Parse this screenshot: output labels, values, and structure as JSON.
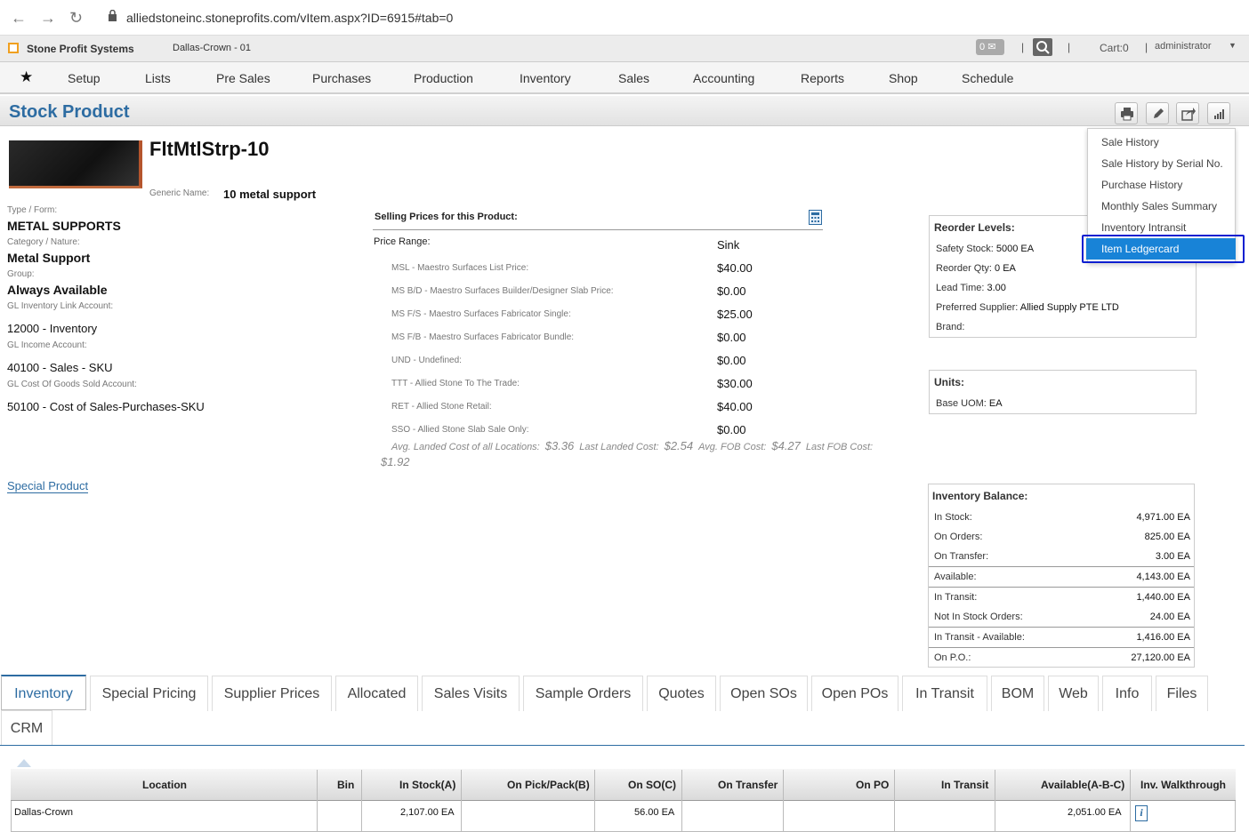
{
  "browser": {
    "url": "alliedstoneinc.stoneprofits.com/vItem.aspx?ID=6915#tab=0"
  },
  "appbar": {
    "app_name": "Stone Profit Systems",
    "location": "Dallas-Crown - 01",
    "msg_count": "0",
    "cart": "Cart:0",
    "user": "administrator"
  },
  "menu": [
    "Setup",
    "Lists",
    "Pre Sales",
    "Purchases",
    "Production",
    "Inventory",
    "Sales",
    "Accounting",
    "Reports",
    "Shop",
    "Schedule"
  ],
  "page": {
    "title": "Stock Product"
  },
  "dropdown": {
    "items": [
      "Sale History",
      "Sale History by Serial No.",
      "Purchase History",
      "Monthly Sales Summary",
      "Inventory Intransit"
    ],
    "selected": "Item Ledgercard"
  },
  "product": {
    "name": "FltMtlStrp-10",
    "generic_label": "Generic Name:",
    "generic_value": "10 metal support",
    "type_label": "Type / Form:",
    "type_value": "METAL SUPPORTS",
    "category_label": "Category / Nature:",
    "category_value": "Metal Support",
    "group_label": "Group:",
    "group_value": "Always Available",
    "gl_inv_label": "GL Inventory Link Account:",
    "gl_inv_value": "12000 - Inventory",
    "gl_inc_label": "GL Income Account:",
    "gl_inc_value": "40100 - Sales - SKU",
    "gl_cogs_label": "GL Cost Of Goods Sold Account:",
    "gl_cogs_value": "50100 - Cost of Sales-Purchases-SKU",
    "special_link": "Special Product"
  },
  "prices": {
    "heading": "Selling Prices for this Product:",
    "range_label": "Price Range:",
    "range_value": "Sink",
    "rows": [
      {
        "label": "MSL - Maestro Surfaces List Price:",
        "value": "$40.00"
      },
      {
        "label": "MS B/D - Maestro Surfaces Builder/Designer Slab Price:",
        "value": "$0.00"
      },
      {
        "label": "MS F/S - Maestro Surfaces Fabricator Single:",
        "value": "$25.00"
      },
      {
        "label": "MS F/B - Maestro Surfaces Fabricator Bundle:",
        "value": "$0.00"
      },
      {
        "label": "UND - Undefined:",
        "value": "$0.00"
      },
      {
        "label": "TTT - Allied Stone To The Trade:",
        "value": "$30.00"
      },
      {
        "label": "RET - Allied Stone Retail:",
        "value": "$40.00"
      },
      {
        "label": "SSO - Allied Stone Slab Sale Only:",
        "value": "$0.00"
      }
    ],
    "avg_landed_label": "Avg. Landed Cost of all Locations:",
    "avg_landed": "$3.36",
    "last_landed_label": "Last Landed Cost:",
    "last_landed": "$2.54",
    "avg_fob_label": "Avg. FOB Cost:",
    "avg_fob": "$4.27",
    "last_fob_label": "Last FOB Cost:",
    "last_fob": "$1.92"
  },
  "reorder": {
    "title": "Reorder Levels:",
    "safety_label": "Safety Stock:",
    "safety": "5000 EA",
    "qty_label": "Reorder Qty:",
    "qty": "0 EA",
    "lead_label": "Lead Time:",
    "lead": "3.00",
    "supplier_label": "Preferred Supplier:",
    "supplier": "Allied Supply PTE LTD",
    "brand_label": "Brand:"
  },
  "units": {
    "title": "Units:",
    "base_label": "Base UOM:",
    "base": "EA"
  },
  "balance": {
    "title": "Inventory Balance:",
    "rows": [
      {
        "label": "In Stock:",
        "value": "4,971.00 EA"
      },
      {
        "label": "On Orders:",
        "value": "825.00 EA"
      },
      {
        "label": "On Transfer:",
        "value": "3.00 EA"
      },
      {
        "label": "Available:",
        "value": "4,143.00 EA"
      },
      {
        "label": "In Transit:",
        "value": "1,440.00 EA"
      },
      {
        "label": "Not In Stock Orders:",
        "value": "24.00 EA"
      },
      {
        "label": "In Transit - Available:",
        "value": "1,416.00 EA"
      },
      {
        "label": "On P.O.:",
        "value": "27,120.00 EA"
      }
    ]
  },
  "tabs": [
    "Inventory",
    "Special Pricing",
    "Supplier Prices",
    "Allocated",
    "Sales Visits",
    "Sample Orders",
    "Quotes",
    "Open SOs",
    "Open POs",
    "In Transit",
    "BOM",
    "Web",
    "Info",
    "Files",
    "CRM"
  ],
  "grid": {
    "headers": [
      "Location",
      "Bin",
      "In Stock(A)",
      "On Pick/Pack(B)",
      "On SO(C)",
      "On Transfer",
      "On PO",
      "In Transit",
      "Available(A-B-C)",
      "Inv. Walkthrough"
    ],
    "rows": [
      {
        "location": "Dallas-Crown",
        "in_stock": "2,107.00 EA",
        "on_so": "56.00 EA",
        "available": "2,051.00 EA"
      }
    ]
  },
  "colors": {
    "accent": "#2d6ca2",
    "selected": "#1883d7",
    "highlight": "#0b1fd0"
  }
}
